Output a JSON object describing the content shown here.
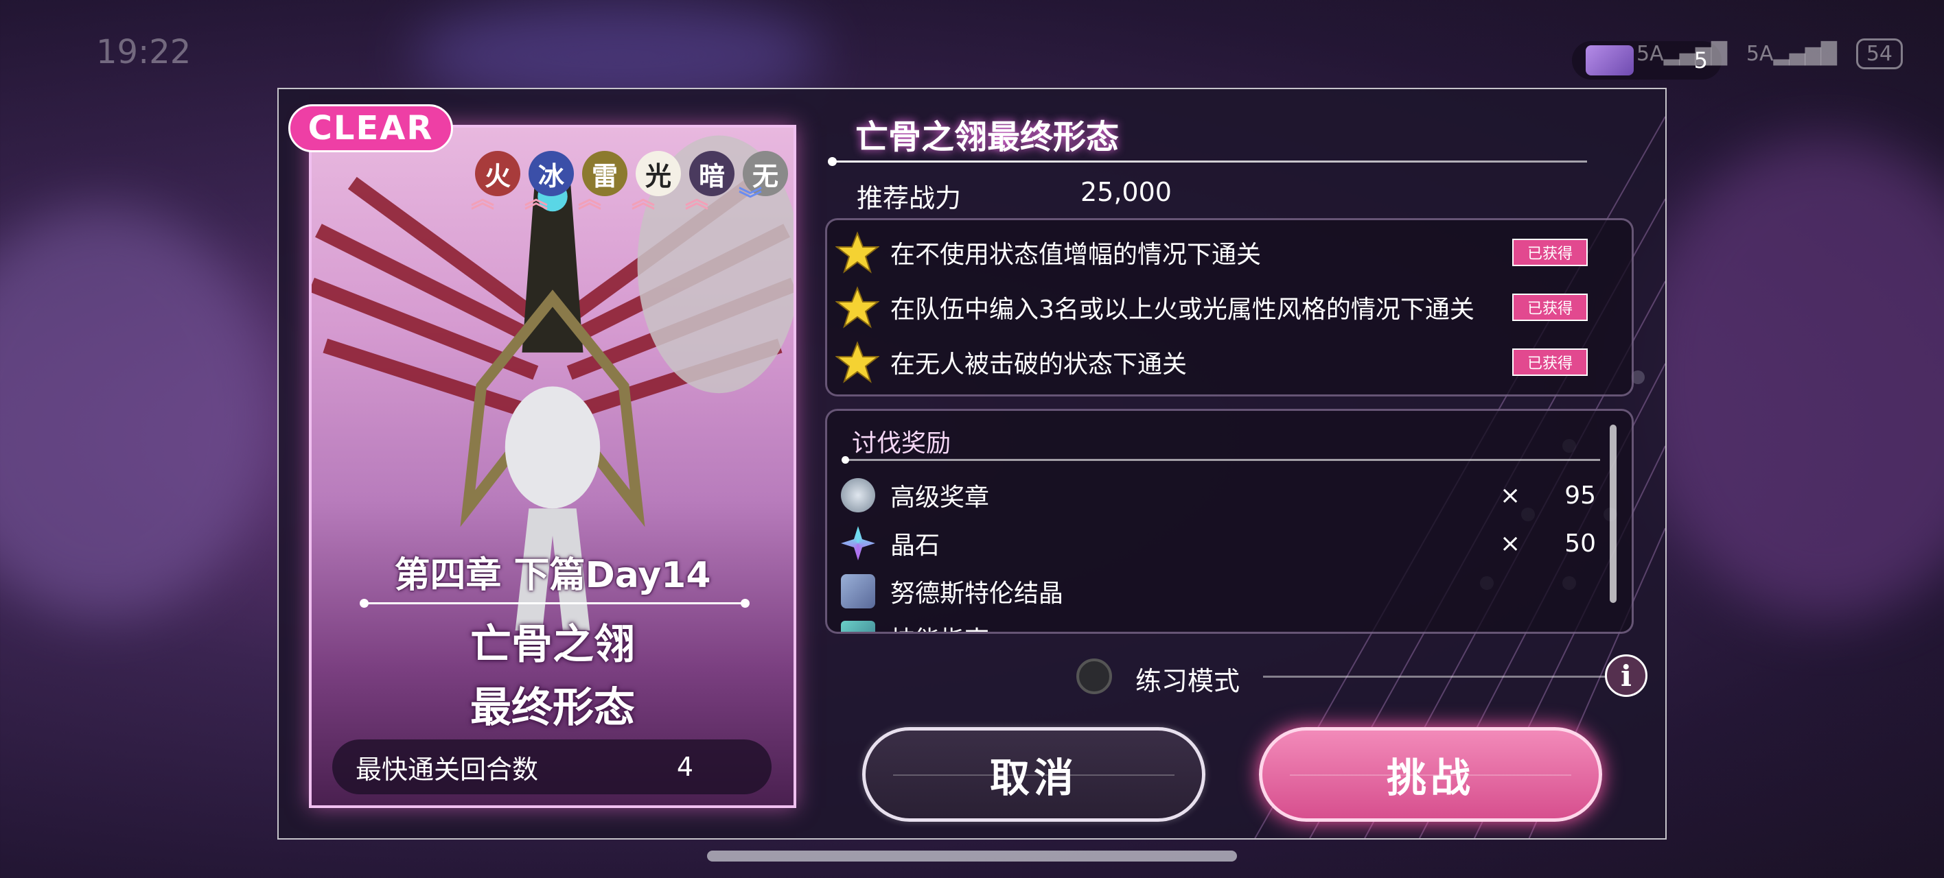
{
  "status_bar": {
    "time": "19:22",
    "ticket_count": "5",
    "signal_1": "5A",
    "signal_2": "5A",
    "battery": "54"
  },
  "card": {
    "badge": "CLEAR",
    "elements": [
      {
        "label": "火",
        "bg": "#a83b3b",
        "arrow": "︽",
        "dir": "up"
      },
      {
        "label": "冰",
        "bg": "#3b4fa8",
        "arrow": "︽",
        "dir": "up"
      },
      {
        "label": "雷",
        "bg": "#8c7a2e",
        "arrow": "︽",
        "dir": "up"
      },
      {
        "label": "光",
        "bg": "#f4f0e6",
        "arrow": "︽",
        "dir": "up"
      },
      {
        "label": "暗",
        "bg": "#4a3a5e",
        "arrow": "︽",
        "dir": "up"
      },
      {
        "label": "无",
        "bg": "#8a8a8a",
        "arrow": "︾",
        "dir": "down"
      }
    ],
    "chapter": "第四章  下篇Day14",
    "boss_name_line1": "亡骨之翎",
    "boss_name_line2": "最终形态",
    "fastest_label": "最快通关回合数",
    "fastest_value": "4"
  },
  "stage": {
    "title": "亡骨之翎最终形态",
    "power_label": "推荐战力",
    "power_value": "25,000",
    "conditions": [
      {
        "text": "在不使用状态值增幅的情况下通关",
        "status": "已获得"
      },
      {
        "text": "在队伍中编入3名或以上火或光属性风格的情况下通关",
        "status": "已获得"
      },
      {
        "text": "在无人被击破的状态下通关",
        "status": "已获得"
      }
    ],
    "rewards_title": "讨伐奖励",
    "rewards": [
      {
        "name": "高级奖章",
        "x": "×",
        "amount": "95"
      },
      {
        "name": "晶石",
        "x": "×",
        "amount": "50"
      },
      {
        "name": "努德斯特伦结晶",
        "x": "",
        "amount": ""
      },
      {
        "name": "技能指南",
        "x": "",
        "amount": ""
      }
    ],
    "practice_label": "练习模式",
    "info_glyph": "i",
    "cancel_label": "取消",
    "challenge_label": "挑战"
  }
}
